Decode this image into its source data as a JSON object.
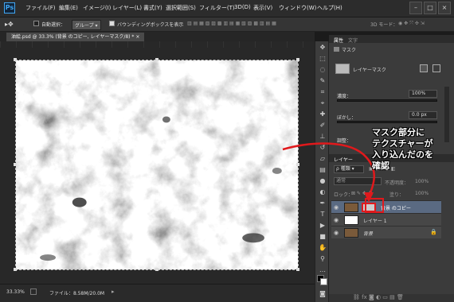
{
  "app": {
    "logo": "Ps"
  },
  "menu": [
    "ファイル(F)",
    "編集(E)",
    "イメージ(I)",
    "レイヤー(L)",
    "書式(Y)",
    "選択範囲(S)",
    "フィルター(T)",
    "3D(D)",
    "表示(V)",
    "ウィンドウ(W)",
    "ヘルプ(H)"
  ],
  "options": {
    "auto_select": "自動選択：",
    "group": "グループ",
    "bounding": "バウンディングボックスを表示",
    "mode_3d": "3D モード："
  },
  "document": {
    "tab_title": "油絵.psd @ 33.3% (背景 のコピー, レイヤーマスク/8) *",
    "close": "×"
  },
  "status": {
    "zoom": "33.33%",
    "file": "ファイル：8.58M/20.0M"
  },
  "properties": {
    "tabs": [
      "属性",
      "文字"
    ],
    "mask_label": "マスク",
    "layer_mask": "レイヤーマスク",
    "density_label": "濃度：",
    "density_value": "100%",
    "feather_label": "ぼかし：",
    "feather_value": "0.0 px",
    "adjust_label": "調整：",
    "density_fraction": 1.0
  },
  "layers_panel": {
    "tab": "レイヤー",
    "kind": "種類",
    "blend": "通常",
    "opacity_label": "不透明度：",
    "opacity_value": "100%",
    "lock_label": "ロック：",
    "fill_label": "塗り：",
    "fill_value": "100%",
    "layers": [
      {
        "name": "背景 のコピー",
        "selected": true
      },
      {
        "name": "レイヤー 1",
        "selected": false
      },
      {
        "name": "背景",
        "selected": false
      }
    ]
  },
  "annotation": {
    "lines": [
      "マスク部分に",
      "テクスチャーが",
      "入り込んだのを",
      "確認"
    ],
    "color": "#e0191c"
  },
  "colors": {
    "accent": "#41a7f3",
    "selection": "#5a6a82",
    "annotation": "#e0191c"
  }
}
